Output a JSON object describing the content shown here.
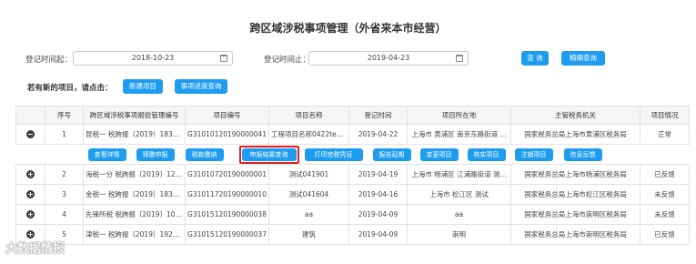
{
  "page": {
    "title": "跨区域涉税事项管理（外省来本市经营）"
  },
  "filters": {
    "start_label": "登记时间起：",
    "start_value": "2018-10-23",
    "end_label": "登记时间止：",
    "end_value": "2019-04-23",
    "query_button": "查 询",
    "precise_button": "精确查询"
  },
  "newitem": {
    "prompt": "若有新的项目，请点击：",
    "new_button": "新建项目",
    "progress_button": "事项进度查询"
  },
  "table": {
    "headers": [
      "",
      "序号",
      "跨区域涉税事项报验管理编号",
      "项目编号",
      "项目名称",
      "登记时间",
      "项目所在地",
      "主管税务机关",
      "项目情况"
    ],
    "rows": [
      {
        "seq": "1",
        "mgmt_no": "昆税一 税跨报〔2019〕1837...",
        "proj_no": "G31010120190000041",
        "name": "工程项目名称0422test1",
        "date": "2019-04-22",
        "location": "上海市 黄浦区 南京东路街道 ...",
        "authority": "国家税务总局上海市黄浦区税务局",
        "status": "正常"
      },
      {
        "seq": "2",
        "mgmt_no": "海税一分 税跨报〔2019〕120...",
        "proj_no": "G31010720190000001",
        "name": "测试041901",
        "date": "2019-04-19",
        "location": "上海市 杨浦区 江浦路街道 测...",
        "authority": "国家税务总局上海市杨浦区税务局",
        "status": "已反馈"
      },
      {
        "seq": "3",
        "mgmt_no": "金税一 税跨报〔2019〕1838...",
        "proj_no": "G31011720190000010",
        "name": "测试041604",
        "date": "2019-04-16",
        "location": "上海市 松江区 测试",
        "authority": "国家税务总局上海市松江区税务局",
        "status": "未反馈"
      },
      {
        "seq": "4",
        "mgmt_no": "先锋所税 税跨报〔2019〕100...",
        "proj_no": "G31015120190000038",
        "name": "aa",
        "date": "2019-04-09",
        "location": "aa",
        "authority": "国家税务总局上海市崇明区税务局",
        "status": "未反馈"
      },
      {
        "seq": "5",
        "mgmt_no": "津税一 税跨报〔2019〕1921...",
        "proj_no": "G31015120190000037",
        "name": "建筑",
        "date": "2019-04-09",
        "location": "崇明",
        "authority": "国家税务总局上海市崇明区税务局",
        "status": "已反馈"
      }
    ]
  },
  "row_actions": [
    "查看详情",
    "预缴申报",
    "税款缴纳",
    "申报结果查询",
    "打印完税凭证",
    "报告延期",
    "变更项目",
    "核实项目",
    "注销项目",
    "信息反馈"
  ],
  "watermark": "大数据情报",
  "colors": {
    "accent": "#1e9df0",
    "highlight": "#e02020"
  }
}
